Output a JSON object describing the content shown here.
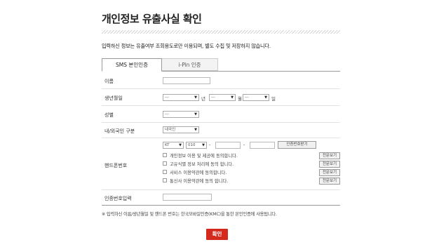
{
  "page": {
    "title": "개인정보 유출사실 확인",
    "intro": "입력하신 정보는 유출여부 조회용도로만 이용되며, 별도 수집 및 저장하지 않습니다."
  },
  "tabs": [
    {
      "label": "SMS 본인인증",
      "active": true
    },
    {
      "label": "i-Pin 인증",
      "active": false
    }
  ],
  "form": {
    "name_label": "이름",
    "name_value": "",
    "birth_label": "생년월일",
    "birth_year": "---",
    "birth_year_unit": "년",
    "birth_month": "---",
    "birth_month_unit": "월",
    "birth_day": "---",
    "birth_day_unit": "일",
    "gender_label": "성별",
    "gender_value": "---",
    "nationality_label": "내/외국인 구분",
    "nationality_value": "내국인",
    "phone_label": "핸드폰번호",
    "carrier_value": "KT",
    "prefix_value": "010",
    "dash": "-",
    "phone_mid": "",
    "phone_last": "",
    "verify_button": "인증번호받기",
    "agreements": [
      {
        "label": "개인정보 이용 및 제공에 동의합니다.",
        "view": "전문보기",
        "checked": false
      },
      {
        "label": "고유식별 정보 처리에 동의 합니다.",
        "view": "전문보기",
        "checked": false
      },
      {
        "label": "서비스 이용약관에 동의합니다.",
        "view": "전문보기",
        "checked": false
      },
      {
        "label": "통신사 이용약관에 동의 합니다.",
        "view": "전문보기",
        "checked": false
      }
    ],
    "code_label": "인증번호입력",
    "code_value": ""
  },
  "note": "※ 입력하신 이름/생년월일 및 핸드폰 번호는 한국모바일인증(KMC)을 통한 본인인증에 사용됩니다.",
  "confirm_button": "확인",
  "colors": {
    "accent": "#d42a1d"
  },
  "icons": {
    "dropdown": "chevron-down-icon",
    "checkbox": "checkbox-icon"
  }
}
